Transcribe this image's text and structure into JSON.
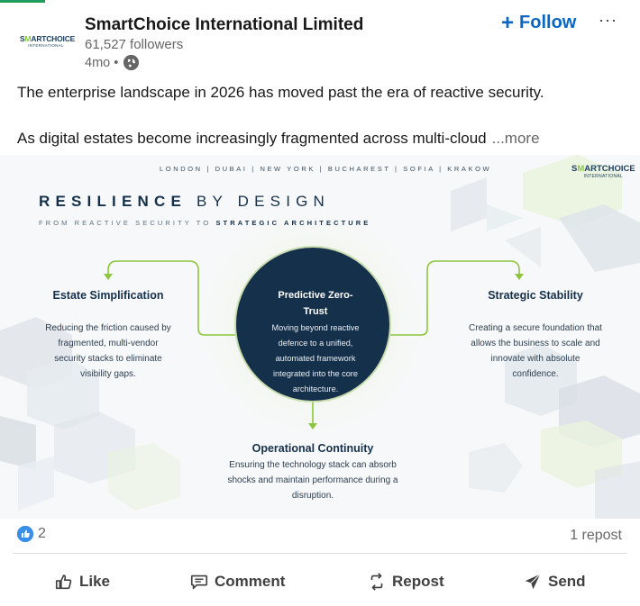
{
  "post": {
    "company_name": "SmartChoice International Limited",
    "followers": "61,527 followers",
    "age": "4mo •",
    "follow_label": "Follow",
    "more_menu": "···",
    "logo_text_top_a": "S",
    "logo_text_top_b": "M",
    "logo_text_top_c": "ARTCHOICE",
    "logo_text_bottom": "INTERNATIONAL",
    "text_line1": "The enterprise landscape in 2026 has moved past the era of reactive security.",
    "text_line2": "As digital estates become increasingly fragmented across multi-cloud",
    "see_more": "...more"
  },
  "graphic": {
    "cities": "LONDON | DUBAI | NEW YORK | BUCHAREST | SOFIA | KRAKOW",
    "title_bold": "RESILIENCE",
    "title_rest": " BY DESIGN",
    "subtitle_plain": "FROM REACTIVE SECURITY TO ",
    "subtitle_bold": "STRATEGIC ARCHITECTURE",
    "pillars": {
      "left": {
        "title": "Estate Simplification",
        "lines": [
          "Reducing the friction caused by",
          "fragmented, multi-vendor",
          "security stacks to eliminate",
          "visibility gaps."
        ]
      },
      "center": {
        "title_l1": "Predictive Zero-",
        "title_l2": "Trust",
        "lines": [
          "Moving beyond reactive",
          "defence to a unified,",
          "automated framework",
          "integrated into the core",
          "architecture."
        ]
      },
      "right": {
        "title": "Strategic Stability",
        "lines": [
          "Creating a secure foundation that",
          "allows the business to scale and",
          "innovate with absolute",
          "confidence."
        ]
      },
      "bottom": {
        "title": "Operational Continuity",
        "lines": [
          "Ensuring the technology stack can absorb",
          "shocks and maintain performance during a",
          "disruption."
        ]
      }
    },
    "colors": {
      "navy": "#15304a",
      "green": "#8cc63f",
      "accent_green": "#1e9e5a"
    }
  },
  "social": {
    "reaction_count": "2",
    "repost_count": "1 repost",
    "actions": {
      "like": "Like",
      "comment": "Comment",
      "repost": "Repost",
      "send": "Send"
    },
    "like_color": "#378fe9",
    "follow_color": "#0a66c2"
  }
}
